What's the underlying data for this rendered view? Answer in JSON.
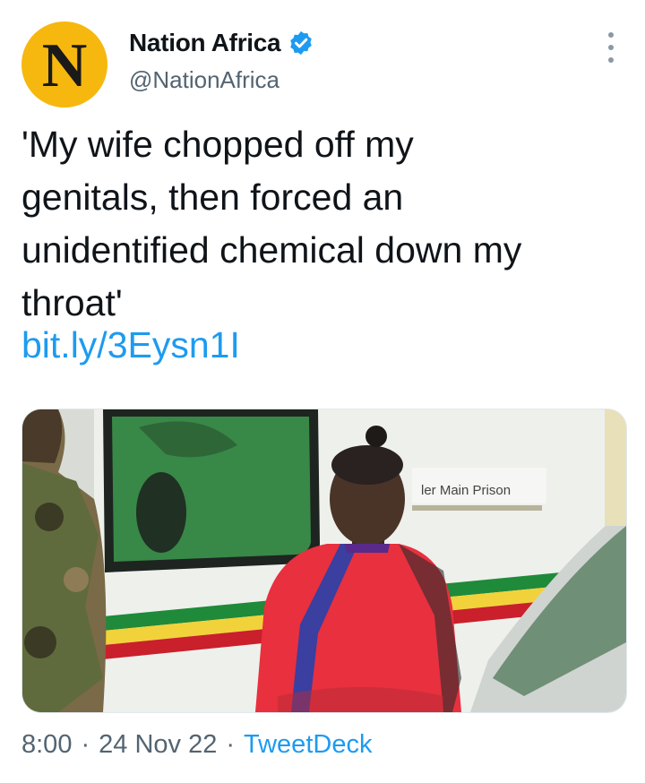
{
  "author": {
    "avatar_letter": "N",
    "display_name": "Nation Africa",
    "handle": "@NationAfrica",
    "verified": true
  },
  "tweet": {
    "text": "'My wife chopped off my\ngenitals, then forced an\nunidentified chemical down my\nthroat'",
    "link": "bit.ly/3Eysn1I"
  },
  "media": {
    "sign_text": "ler  Main Prison"
  },
  "meta": {
    "time": "8:00",
    "separator1": "·",
    "date": "24 Nov 22",
    "separator2": "·",
    "source": "TweetDeck"
  },
  "colors": {
    "link": "#1d9bf0",
    "avatar_bg": "#f6b80f",
    "verified": "#1d9bf0"
  }
}
